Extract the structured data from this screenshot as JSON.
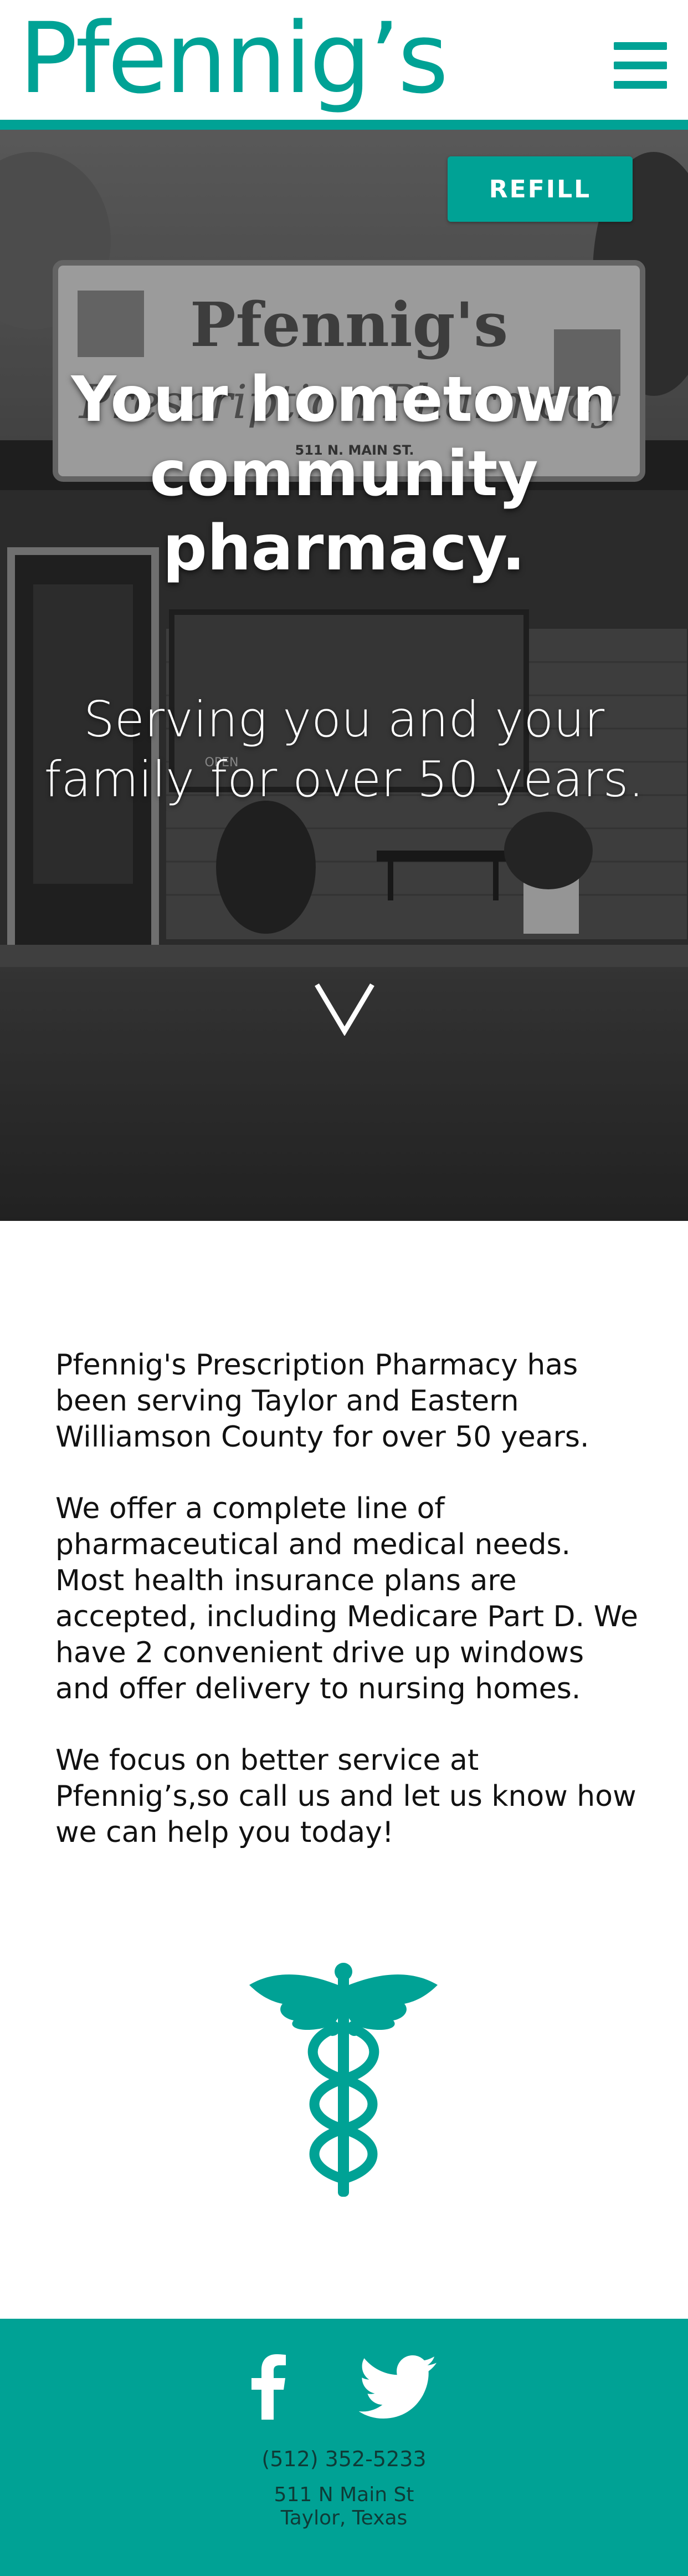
{
  "header": {
    "logo_text": "Pfennig’s",
    "menu_icon": "hamburger-menu-icon"
  },
  "hero": {
    "refill_label": "REFILL",
    "title": "Your hometown community pharmacy.",
    "subtitle": "Serving you and your family for over 50 years.",
    "scroll_icon": "chevron-down-icon",
    "sign_text": "Pfennig's",
    "sign_subtext": "Prescription Pharmacy",
    "sign_address": "511 N. MAIN ST.",
    "door_sign": "OPEN"
  },
  "about": {
    "paragraphs": [
      "Pfennig's Prescription Pharmacy has been serving Taylor and Eastern Williamson County for over 50 years.",
      "We offer a complete line of pharmaceutical and medical needs. Most health insurance plans are accepted, including Medicare Part D. We have 2 convenient drive up windows and offer delivery to nursing homes.",
      "We focus on better service at Pfennig’s,so call us and let us know how we can help you today!"
    ],
    "emblem_icon": "caduceus-icon"
  },
  "footer": {
    "social": [
      "facebook-icon",
      "twitter-icon"
    ],
    "phone": "(512) 352-5233",
    "address_line1": "511 N Main St",
    "address_line2": "Taylor, Texas"
  },
  "colors": {
    "accent": "#00a295",
    "footer_text": "#0f3b37"
  }
}
